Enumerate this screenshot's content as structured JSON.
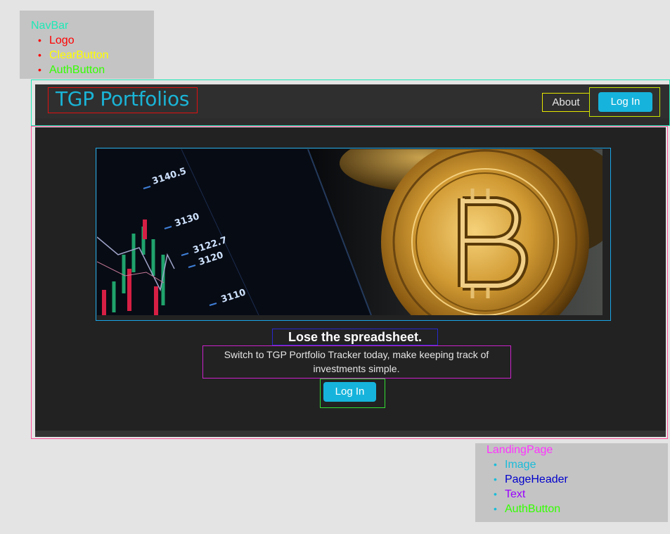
{
  "legends": {
    "navbar": {
      "title": "NavBar",
      "title_color": "#1de9b6",
      "items": [
        {
          "label": "Logo",
          "color": "#ff0000"
        },
        {
          "label": "ClearButton",
          "color": "#ffff00"
        },
        {
          "label": "AuthButton",
          "color": "#33ff00"
        }
      ]
    },
    "landing": {
      "title": "LandingPage",
      "title_color": "#ff33ff",
      "items": [
        {
          "label": "Image",
          "color": "#1abcd9"
        },
        {
          "label": "PageHeader",
          "color": "#0000cc"
        },
        {
          "label": "Text",
          "color": "#9900ff"
        },
        {
          "label": "AuthButton",
          "color": "#33ff00"
        }
      ]
    }
  },
  "navbar": {
    "logo": "TGP Portfolios",
    "about_label": "About",
    "login_label": "Log In"
  },
  "landing": {
    "image_icon": "bitcoin-chart-image",
    "chart_labels": [
      "3140.5",
      "3130",
      "3122.7",
      "3120",
      "3110"
    ],
    "header": "Lose the spreadsheet.",
    "text": "Switch to TGP Portfolio Tracker today, make keeping track of investments simple.",
    "login_label": "Log In"
  },
  "colors": {
    "accent": "#16b4dc",
    "navbar_bg": "#2f2f2f",
    "page_bg": "#222222"
  }
}
